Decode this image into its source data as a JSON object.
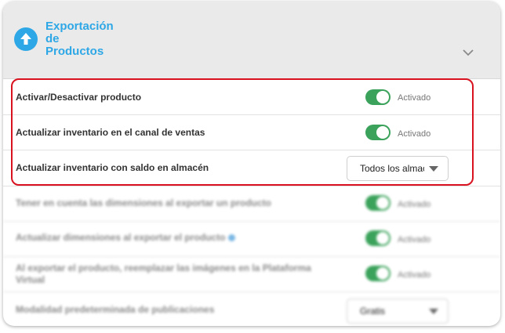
{
  "header": {
    "title_line1": "Exportación",
    "title_line2": "de",
    "title_line3": "Productos",
    "icon": "arrow-up-circle-icon",
    "collapse_icon": "chevron-down-icon",
    "accent_color": "#2ea7e6"
  },
  "settings": [
    {
      "label": "Activar/Desactivar producto",
      "control": "toggle",
      "state": "Activado",
      "on": true
    },
    {
      "label": "Actualizar inventario en el canal de ventas",
      "control": "toggle",
      "state": "Activado",
      "on": true
    },
    {
      "label": "Actualizar inventario con saldo en almacén",
      "control": "select",
      "value": "Todos los almac"
    },
    {
      "label": "Tener en cuenta las dimensiones al exportar un producto",
      "control": "toggle",
      "state": "Activado",
      "on": true
    },
    {
      "label": "Actualizar dimensiones al exportar el producto",
      "control": "toggle",
      "state": "Activado",
      "on": true,
      "info_icon": "info-icon"
    },
    {
      "label": "Al exportar el producto, reemplazar las imágenes en la Plataforma Virtual",
      "control": "toggle",
      "state": "Activado",
      "on": true
    },
    {
      "label": "Modalidad predeterminada de publicaciones",
      "control": "select",
      "value": "Gratis"
    }
  ],
  "colors": {
    "toggle_on": "#3aa25a",
    "highlight_border": "#d8121f"
  }
}
